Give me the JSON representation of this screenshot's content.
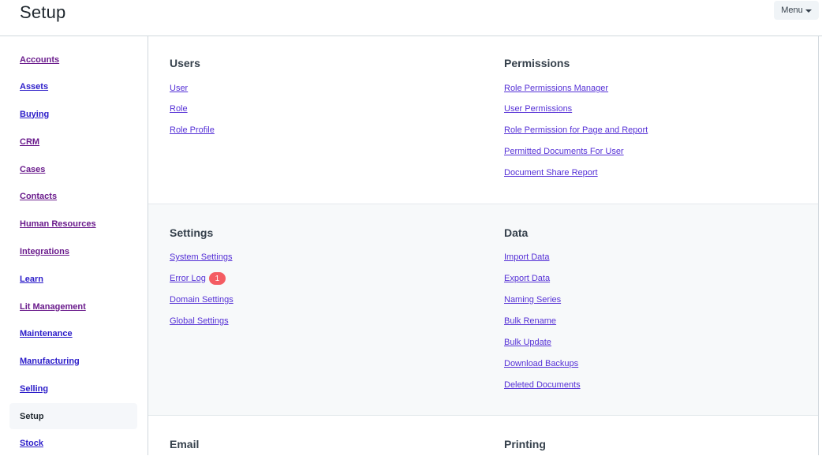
{
  "header": {
    "title": "Setup",
    "menu_label": "Menu"
  },
  "sidebar": {
    "items": [
      {
        "label": "Accounts"
      },
      {
        "label": "Assets"
      },
      {
        "label": "Buying"
      },
      {
        "label": "CRM"
      },
      {
        "label": "Cases"
      },
      {
        "label": "Contacts"
      },
      {
        "label": "Human Resources"
      },
      {
        "label": "Integrations"
      },
      {
        "label": "Learn"
      },
      {
        "label": "Lit Management"
      },
      {
        "label": "Maintenance"
      },
      {
        "label": "Manufacturing"
      },
      {
        "label": "Selling"
      },
      {
        "label": "Setup"
      },
      {
        "label": "Stock"
      }
    ]
  },
  "sections": [
    {
      "left": {
        "title": "Users",
        "links": [
          "User",
          "Role",
          "Role Profile"
        ]
      },
      "right": {
        "title": "Permissions",
        "links": [
          "Role Permissions Manager",
          "User Permissions",
          "Role Permission for Page and Report",
          "Permitted Documents For User",
          "Document Share Report"
        ]
      }
    },
    {
      "left": {
        "title": "Settings",
        "links": [
          "System Settings",
          "Error Log",
          "Domain Settings",
          "Global Settings"
        ],
        "error_log_badge": "1"
      },
      "right": {
        "title": "Data",
        "links": [
          "Import Data",
          "Export Data",
          "Naming Series",
          "Bulk Rename",
          "Bulk Update",
          "Download Backups",
          "Deleted Documents"
        ]
      }
    },
    {
      "left": {
        "title": "Email"
      },
      "right": {
        "title": "Printing"
      }
    }
  ]
}
